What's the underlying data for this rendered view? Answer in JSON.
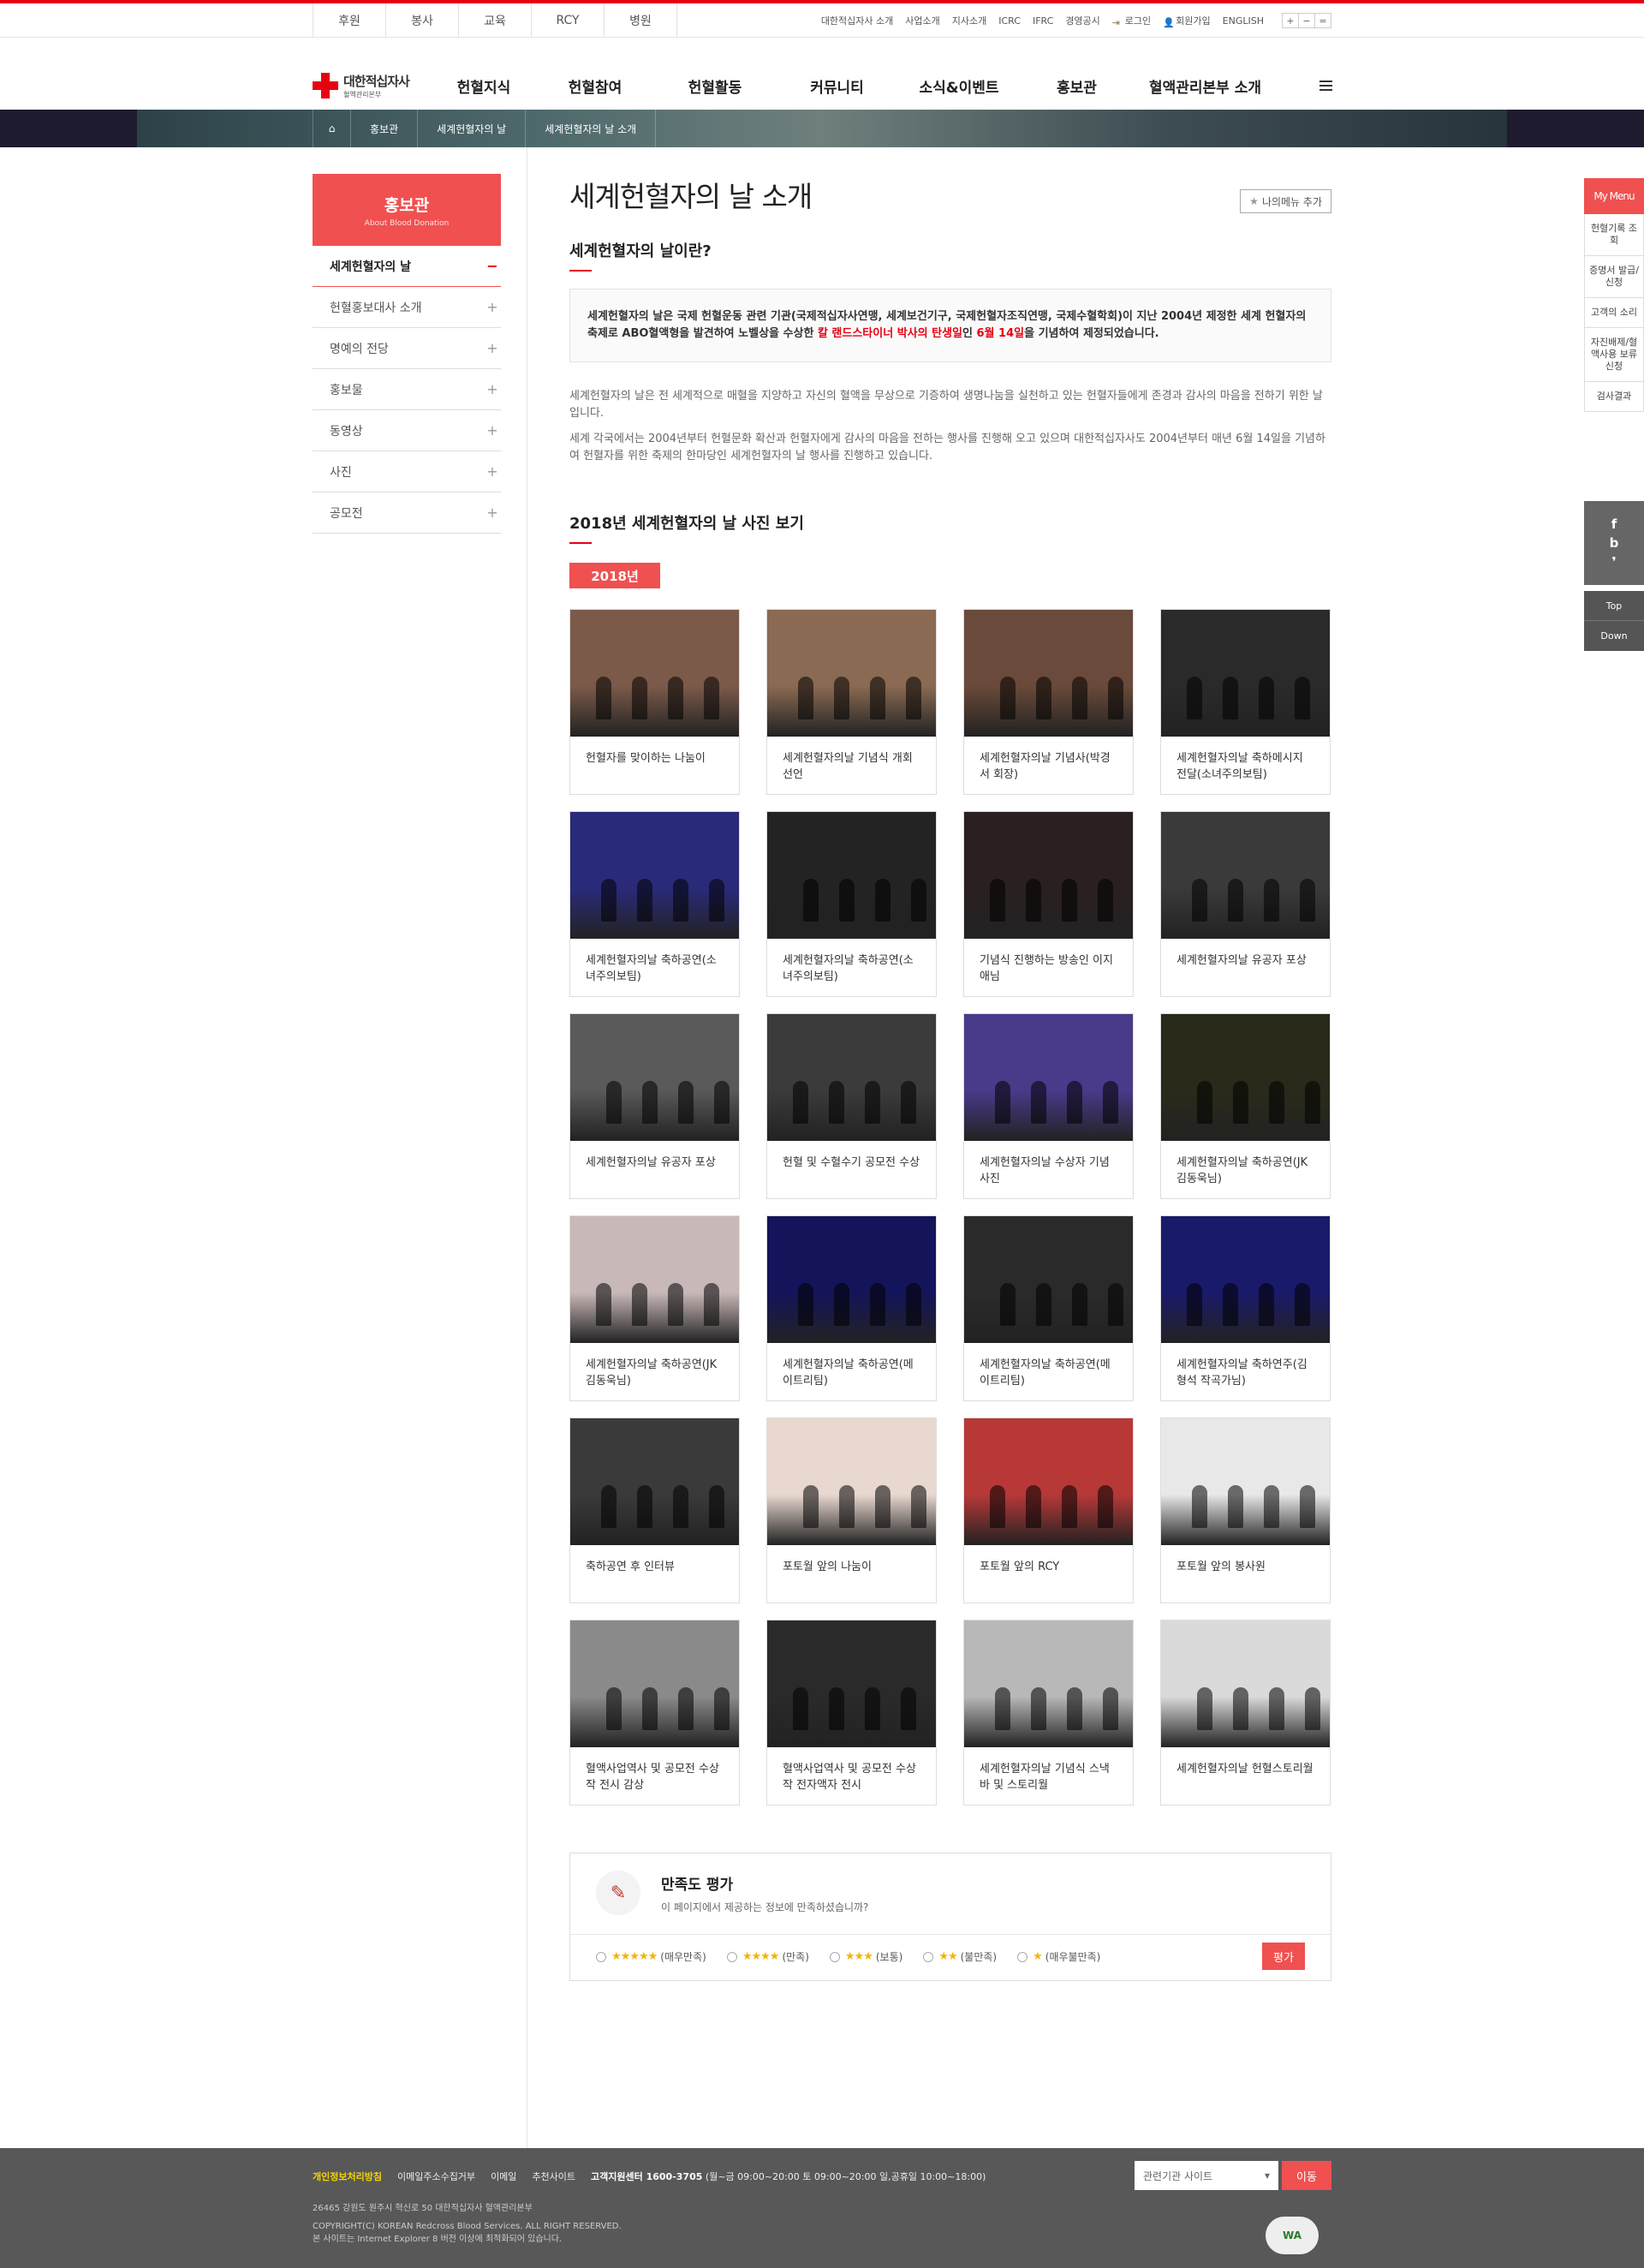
{
  "util": {
    "left": [
      "후원",
      "봉사",
      "교육",
      "RCY",
      "병원"
    ],
    "right": [
      "대한적십자사 소개",
      "사업소개",
      "지사소개",
      "ICRC",
      "IFRC",
      "경영공시"
    ],
    "login": "로그인",
    "join": "회원가입",
    "english": "ENGLISH",
    "font_buttons": [
      "+",
      "−",
      "="
    ]
  },
  "logo": {
    "name": "대한적십자사",
    "sub": "혈액관리본부"
  },
  "gnb": [
    "헌혈지식",
    "헌혈참여",
    "헌혈활동",
    "커뮤니티",
    "소식&이벤트",
    "홍보관",
    "혈액관리본부 소개"
  ],
  "breadcrumb": [
    "홍보관",
    "세계헌혈자의 날",
    "세계헌혈자의 날 소개"
  ],
  "snb": {
    "title": "홍보관",
    "sub": "About Blood Donation",
    "items": [
      "세계헌혈자의 날",
      "헌혈홍보대사 소개",
      "명예의 전당",
      "홍보물",
      "동영상",
      "사진",
      "공모전"
    ]
  },
  "page": {
    "title": "세계헌혈자의 날 소개",
    "mymenu_btn": "나의메뉴 추가",
    "section1": "세계헌혈자의 날이란?",
    "intro_a": "세계헌혈자의 날은 국제 헌혈운동 관련 기관(국제적십자사연맹, 세계보건기구, 국제헌혈자조직연맹, 국제수혈학회)이 지난 2004년 제정한 세계 헌혈자의 축제로 ABO혈액형을 발견하여 노벨상을 수상한 ",
    "intro_red1": "칼 랜드스타이너 박사의 탄생일",
    "intro_b": "인 ",
    "intro_red2": "6월 14일",
    "intro_c": "을 기념하여 제정되었습니다.",
    "para1": "세계헌혈자의 날은 전 세계적으로 매혈을 지양하고 자신의 혈액을 무상으로 기증하여 생명나눔을 실천하고 있는 헌혈자들에게 존경과 감사의 마음을 전하기 위한 날입니다.",
    "para2": "세계 각국에서는 2004년부터 헌혈문화 확산과 헌혈자에게 감사의 마음을 전하는 행사를 진행해 오고 있으며 대한적십자사도 2004년부터 매년 6월 14일을 기념하여 헌혈자를 위한 축제의 한마당인 세계헌혈자의 날 행사를 진행하고 있습니다.",
    "gallery_title": "2018년 세계헌혈자의 날 사진 보기",
    "year_tab": "2018년"
  },
  "gallery": [
    "헌혈자를 맞이하는 나눔이",
    "세계헌혈자의날 기념식 개회 선언",
    "세계헌혈자의날 기념사(박경서 회장)",
    "세계헌혈자의날 축하메시지 전달(소녀주의보팀)",
    "세계헌혈자의날 축하공연(소녀주의보팀)",
    "세계헌혈자의날 축하공연(소녀주의보팀)",
    "기념식 진행하는 방송인 이지애님",
    "세계헌혈자의날 유공자 포상",
    "세계헌혈자의날 유공자 포상",
    "헌혈 및 수혈수기 공모전 수상",
    "세계헌혈자의날 수상자 기념사진",
    "세계헌혈자의날 축하공연(JK 김동욱님)",
    "세계헌혈자의날 축하공연(JK 김동욱님)",
    "세계헌혈자의날 축하공연(메이트리팀)",
    "세계헌혈자의날 축하공연(메이트리팀)",
    "세계헌혈자의날 축하연주(김형석 작곡가님)",
    "축하공연 후 인터뷰",
    "포토월 앞의 나눔이",
    "포토월 앞의 RCY",
    "포토월 앞의 봉사원",
    "혈액사업역사 및 공모전 수상작 전시 감상",
    "혈액사업역사 및 공모전 수상작 전자액자 전시",
    "세계헌혈자의날 기념식 스낵바 및 스토리월",
    "세계헌혈자의날 헌혈스토리월"
  ],
  "gallery_colors": [
    "#7b5a4a",
    "#8a6a52",
    "#6a4a3a",
    "#2a2a2a",
    "#2a2a7a",
    "#232323",
    "#2a2020",
    "#3a3a3a",
    "#5a5a5a",
    "#3b3b3b",
    "#4a3a8a",
    "#2a2a1a",
    "#c9b8b8",
    "#14145a",
    "#2a2a2a",
    "#1a1a6a",
    "#3a3a3a",
    "#e8d8d0",
    "#b83838",
    "#e8e8e8",
    "#8a8a8a",
    "#2a2a2a",
    "#b8b8b8",
    "#dadada"
  ],
  "survey": {
    "title": "만족도 평가",
    "desc": "이 페이지에서 제공하는 정보에 만족하셨습니까?",
    "options": [
      {
        "stars": "★★★★★",
        "label": "(매우만족)"
      },
      {
        "stars": "★★★★",
        "label": "(만족)"
      },
      {
        "stars": "★★★",
        "label": "(보통)"
      },
      {
        "stars": "★★",
        "label": "(불만족)"
      },
      {
        "stars": "★",
        "label": "(매우불만족)"
      }
    ],
    "submit": "평가"
  },
  "quickmenu": {
    "title": "My Menu",
    "items": [
      "헌혈기록 조회",
      "증명서 발급/신청",
      "고객의 소리",
      "자진배제/혈액사용 보류신청",
      "검사결과"
    ]
  },
  "sns": [
    "f",
    "b",
    "❜"
  ],
  "topdown": [
    "Top",
    "Down"
  ],
  "footer": {
    "privacy": "개인정보처리방침",
    "links": [
      "이메일주소수집거부",
      "이메일",
      "추천사이트"
    ],
    "tel_label": "고객지원센터 1600-3705",
    "tel_hours": "(월~금 09:00~20:00 토 09:00~20:00 일,공휴일 10:00~18:00)",
    "address": "26465 강원도 원주시 혁신로 50 대한적십자사 혈액관리본부",
    "copyright": "COPYRIGHT(C) KOREAN Redcross Blood Services. ALL RIGHT RESERVED.",
    "browser": "본 사이트는 Internet Explorer 8 버전 이상에 최적화되어 있습니다.",
    "select": "관련기관 사이트",
    "go": "이동",
    "wa": "WA"
  },
  "colors": {
    "brand_red": "#e60012",
    "accent": "#f05050",
    "footer_bg": "#585858"
  }
}
